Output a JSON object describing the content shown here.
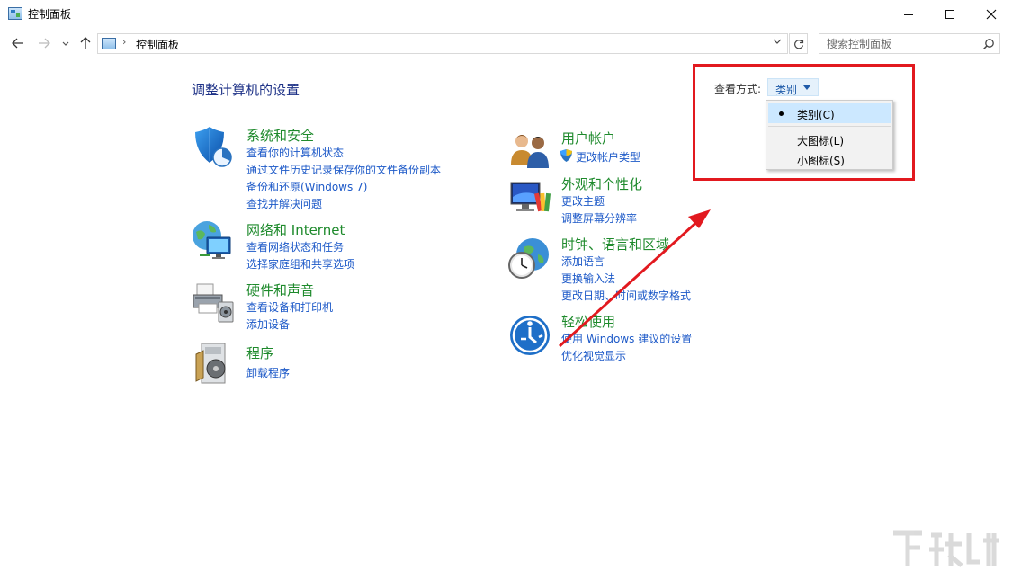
{
  "window": {
    "title": "控制面板"
  },
  "navigation": {
    "breadcrumb": "控制面板",
    "search_placeholder": "搜索控制面板"
  },
  "main": {
    "heading": "调整计算机的设置",
    "view_by_label": "查看方式:",
    "view_by_value": "类别",
    "view_options": [
      "类别(C)",
      "大图标(L)",
      "小图标(S)"
    ]
  },
  "categories": {
    "security": {
      "title": "系统和安全",
      "links": [
        "查看你的计算机状态",
        "通过文件历史记录保存你的文件备份副本",
        "备份和还原(Windows 7)",
        "查找并解决问题"
      ]
    },
    "network": {
      "title": "网络和 Internet",
      "links": [
        "查看网络状态和任务",
        "选择家庭组和共享选项"
      ]
    },
    "hardware": {
      "title": "硬件和声音",
      "links": [
        "查看设备和打印机",
        "添加设备"
      ]
    },
    "programs": {
      "title": "程序",
      "links": [
        "卸载程序"
      ]
    },
    "accounts": {
      "title": "用户帐户",
      "links": [
        "更改帐户类型"
      ]
    },
    "appearance": {
      "title": "外观和个性化",
      "links": [
        "更改主题",
        "调整屏幕分辨率"
      ]
    },
    "clock": {
      "title": "时钟、语言和区域",
      "links": [
        "添加语言",
        "更换输入法",
        "更改日期、时间或数字格式"
      ]
    },
    "ease": {
      "title": "轻松使用",
      "links": [
        "使用 Windows 建议的设置",
        "优化视觉显示"
      ]
    }
  },
  "colors": {
    "category_title": "#1e8a2c",
    "link": "#1e5ac8",
    "heading": "#1e3287",
    "annotation": "#e2191f"
  },
  "icons": [
    "back-arrow-icon",
    "forward-arrow-icon",
    "up-arrow-icon",
    "refresh-icon",
    "search-icon",
    "shield-icon",
    "network-globe-icon",
    "printer-icon",
    "programs-icon",
    "users-icon",
    "monitor-palette-icon",
    "clock-globe-icon",
    "ease-of-access-icon"
  ]
}
